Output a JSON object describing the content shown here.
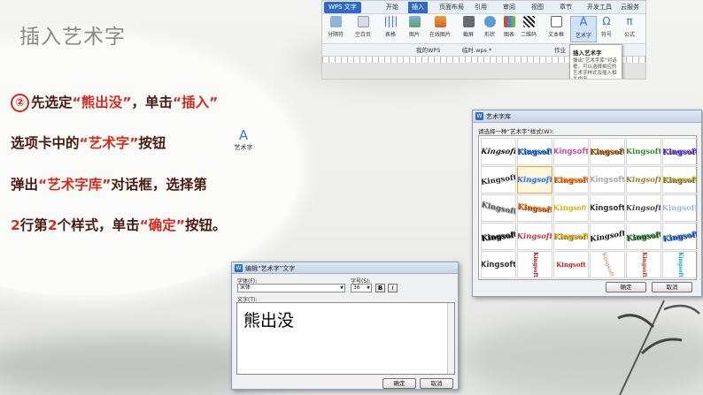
{
  "slide": {
    "title": "插入艺术字",
    "step_number": "②",
    "lines": [
      {
        "parts": [
          "先选定",
          "“熊出没”",
          "，单击",
          "“插入”"
        ]
      },
      {
        "parts": [
          "选项卡中的",
          "“艺术字”",
          "按钮"
        ]
      },
      {
        "parts": [
          "弹出",
          "“艺术字库”",
          "对话框，选择第"
        ]
      },
      {
        "parts": [
          "2",
          "行第",
          "2",
          "个样式，单击",
          "“确定”",
          "按钮。"
        ]
      }
    ],
    "art_icon": {
      "glyph": "A",
      "caption": "艺术字"
    }
  },
  "wps": {
    "app_button": "WPS 文字",
    "tabs": [
      "开始",
      "插入",
      "页面布局",
      "引用",
      "审阅",
      "视图",
      "章节",
      "开发工具",
      "云服务"
    ],
    "active_tab": "插入",
    "toolbar": [
      "分隔符",
      "空白页",
      "表格",
      "图片",
      "在线图片",
      "截屏",
      "形状",
      "图表",
      "二维码",
      "文本框",
      "艺术字",
      "符号",
      "公式"
    ],
    "doc_tabs": [
      "我的WPS",
      "临时.wps *",
      "作业"
    ],
    "tooltip": {
      "title": "插入艺术字",
      "body": "弹出“艺术字库”对话框，可以选择相应的艺术字样式及插入相关内容。"
    }
  },
  "gallery": {
    "title": "艺术字库",
    "prompt": "请选择一种“艺术字”样式(W):",
    "sample": "Kingsoft",
    "ok_label": "确定",
    "cancel_label": "取消",
    "selected": {
      "row": 2,
      "col": 2
    }
  },
  "editor": {
    "title": "编辑“艺术字”文字",
    "font_label": "字体(F):",
    "font_value": "宋体",
    "size_label": "字号(S):",
    "size_value": "36",
    "bold_label": "B",
    "italic_label": "I",
    "text_label": "文字(T):",
    "text_value": "熊出没",
    "ok_label": "确定",
    "cancel_label": "取消"
  },
  "colors": {
    "accent_red": "#d42a1c",
    "text_dark": "#4a1a12",
    "wps_blue": "#2f6cc0"
  }
}
